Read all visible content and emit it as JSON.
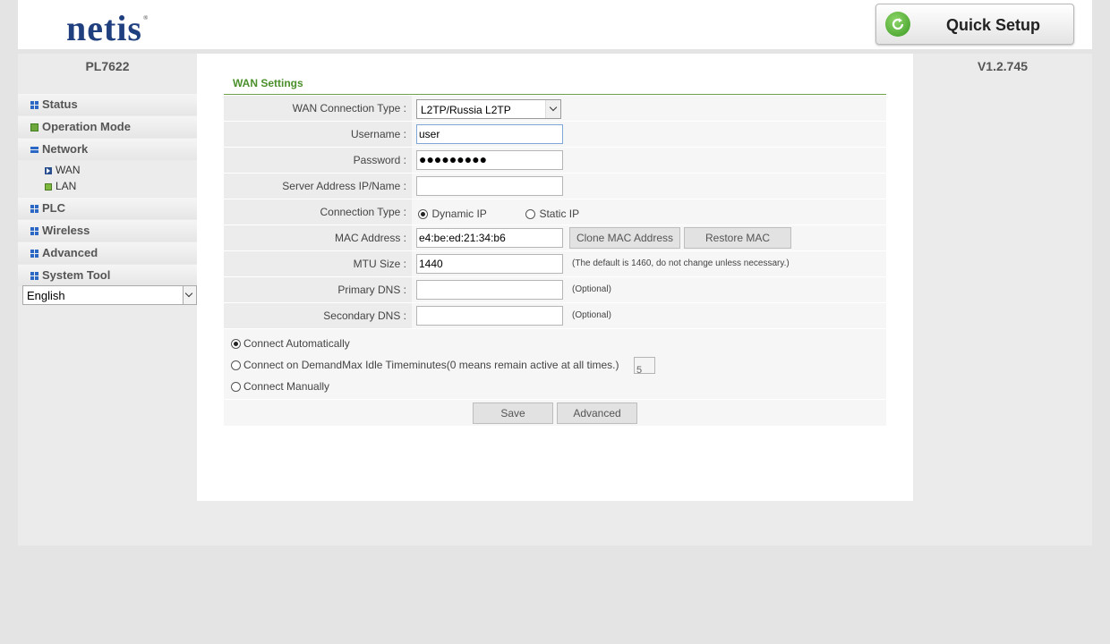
{
  "brand": {
    "logo_text": "netis",
    "reg_mark": "®"
  },
  "quick_setup": {
    "label": "Quick Setup"
  },
  "device": {
    "model": "PL7622",
    "version": "V1.2.745"
  },
  "sidebar": {
    "items": [
      {
        "label": "Status",
        "icon": "grid-icon"
      },
      {
        "label": "Operation Mode",
        "icon": "star-icon"
      },
      {
        "label": "Network",
        "icon": "minus-icon",
        "expanded": true
      },
      {
        "label": "PLC",
        "icon": "grid-icon"
      },
      {
        "label": "Wireless",
        "icon": "grid-icon"
      },
      {
        "label": "Advanced",
        "icon": "grid-icon"
      },
      {
        "label": "System Tool",
        "icon": "grid-icon"
      }
    ],
    "network_sub": [
      {
        "label": "WAN",
        "icon": "arrow-icon",
        "selected": true
      },
      {
        "label": "LAN",
        "icon": "star-icon"
      }
    ],
    "language": "English"
  },
  "wan": {
    "title": "WAN Settings",
    "connection_type_label": "WAN Connection Type :",
    "connection_type_value": "L2TP/Russia L2TP",
    "username_label": "Username :",
    "username_value": "user",
    "password_label": "Password :",
    "password_value": "●●●●●●●●●",
    "server_label": "Server Address IP/Name :",
    "server_value": "",
    "conn_type_label": "Connection Type :",
    "dynamic_ip": "Dynamic IP",
    "static_ip": "Static IP",
    "conn_type_selected": "Dynamic IP",
    "mac_label": "MAC Address :",
    "mac_value": "e4:be:ed:21:34:b6",
    "clone_mac": "Clone MAC Address",
    "restore_mac": "Restore MAC",
    "mtu_label": "MTU Size :",
    "mtu_value": "1440",
    "mtu_hint": "(The default is 1460, do not change unless necessary.)",
    "primary_dns_label": "Primary DNS :",
    "primary_dns_value": "",
    "secondary_dns_label": "Secondary DNS :",
    "secondary_dns_value": "",
    "optional_hint": "(Optional)",
    "connect_auto": "Connect Automatically",
    "connect_demand": "Connect on DemandMax Idle Timeminutes(0 means remain active at all times.)",
    "idle_value": "5",
    "connect_manual": "Connect Manually",
    "connect_selected": "Connect Automatically",
    "save": "Save",
    "advanced": "Advanced"
  }
}
